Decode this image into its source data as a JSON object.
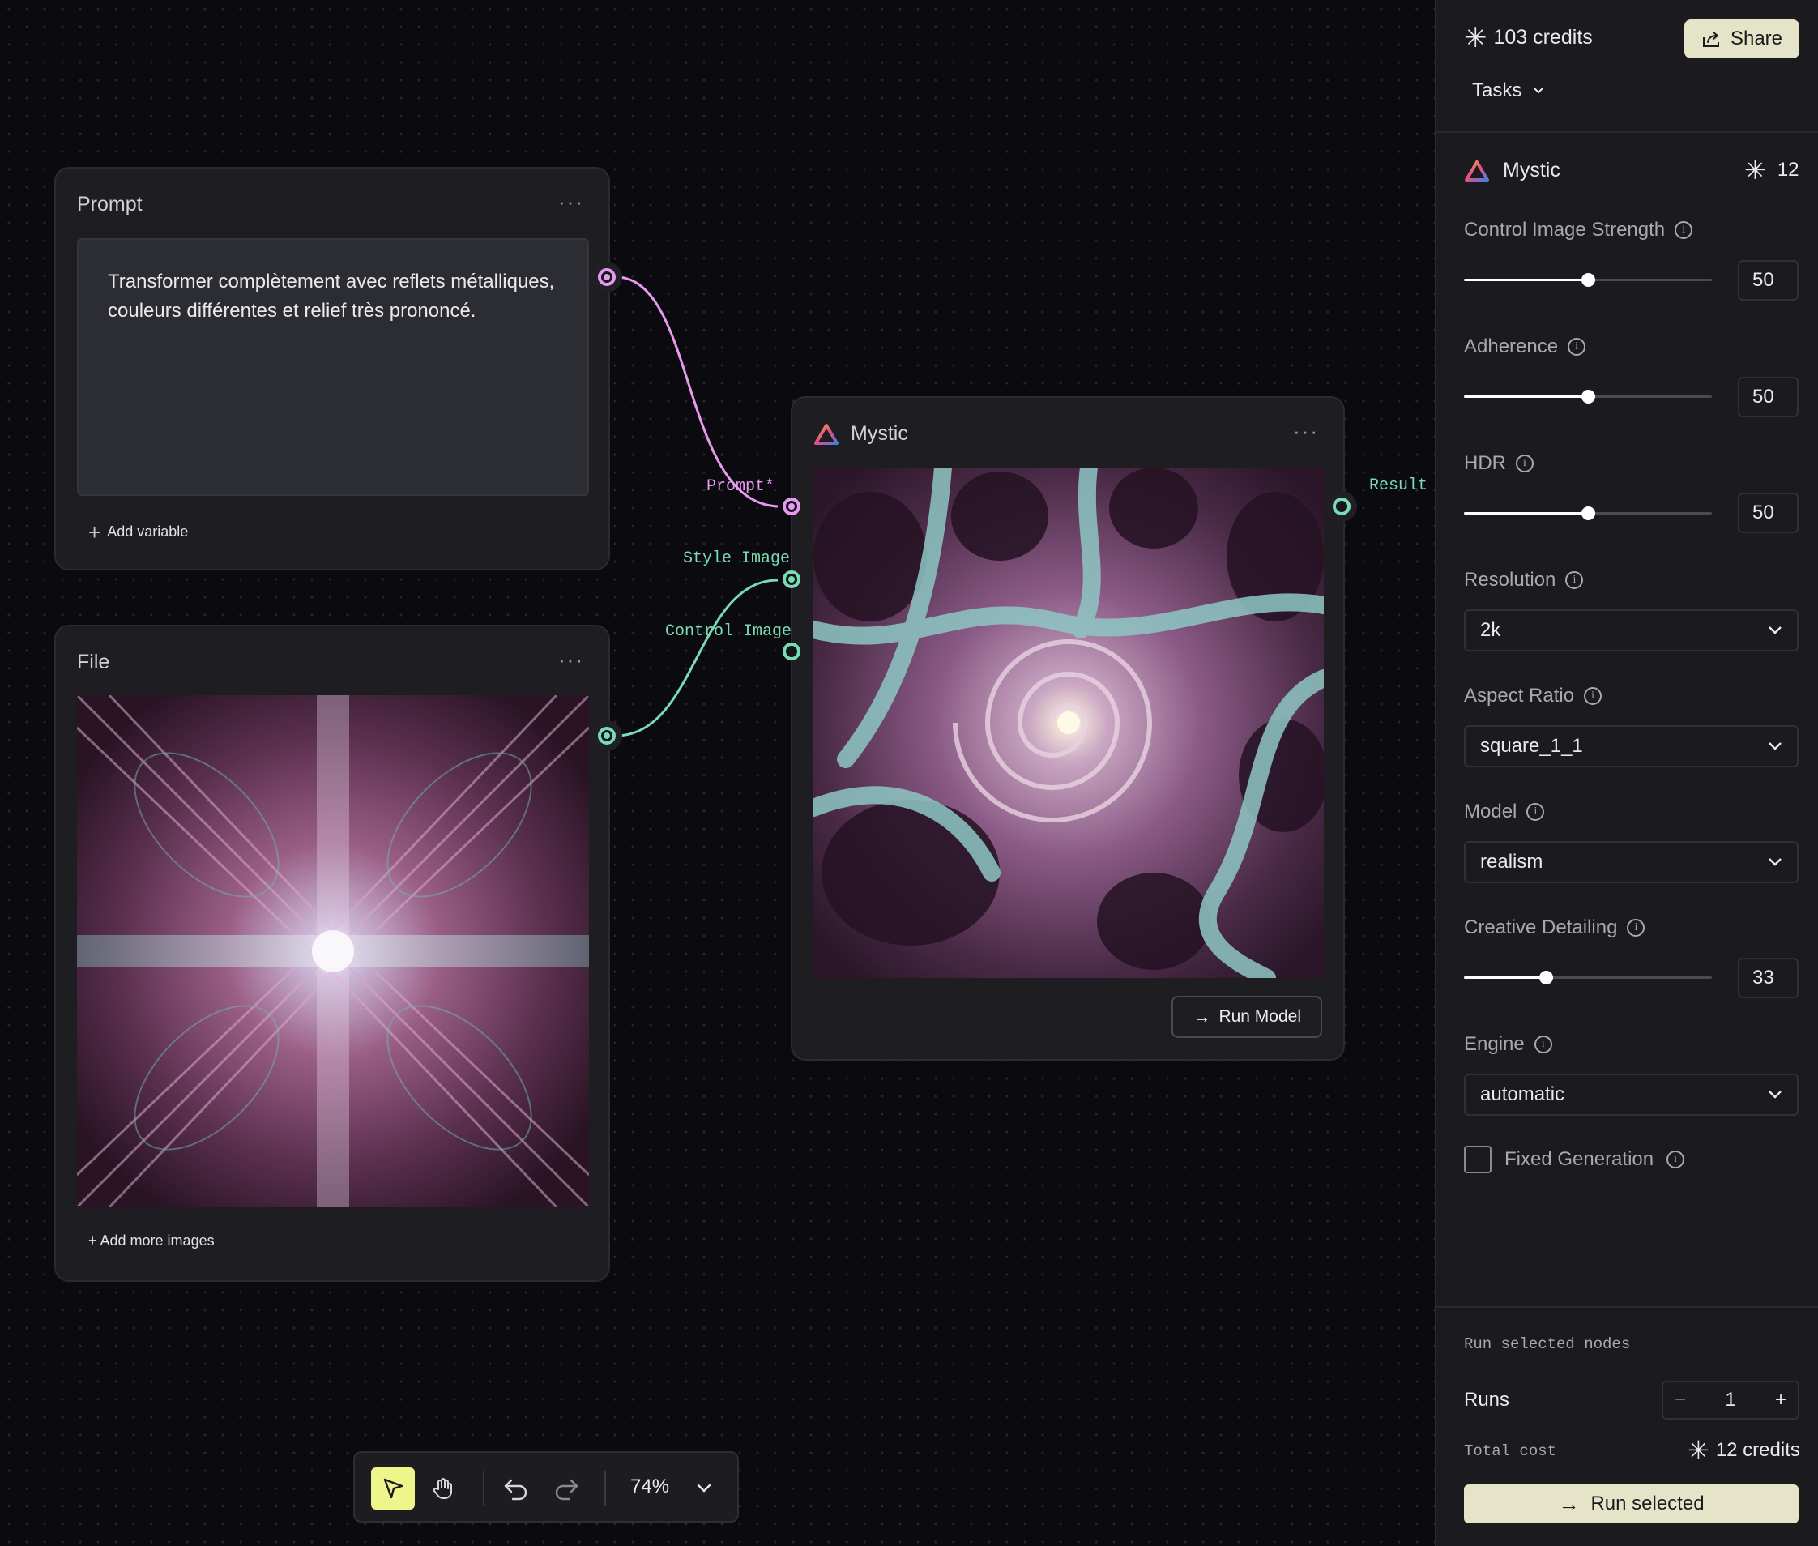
{
  "canvas": {
    "prompt_node": {
      "title": "Prompt",
      "text": "Transformer complètement avec reflets métalliques, couleurs différentes et relief très prononcé.",
      "add_variable": "Add variable",
      "menu": "···"
    },
    "file_node": {
      "title": "File",
      "add_more": "+ Add more images",
      "menu": "···"
    },
    "mystic_node": {
      "title": "Mystic",
      "menu": "···",
      "run_button": "Run Model",
      "inputs": {
        "prompt": "Prompt*",
        "style_image": "Style Image",
        "control_image": "Control Image"
      },
      "output": "Result"
    },
    "colors": {
      "prompt_wire": "#e79bf0",
      "image_wire": "#78dcb4"
    }
  },
  "toolbar": {
    "zoom": "74%",
    "select_tool_icon": "pointer-icon",
    "pan_tool_icon": "hand-icon"
  },
  "panel": {
    "credits": "103 credits",
    "share": "Share",
    "tasks": "Tasks",
    "model_name": "Mystic",
    "model_cost": "12",
    "fields": {
      "control_image_strength": {
        "label": "Control Image Strength",
        "value": "50",
        "level": 0.5
      },
      "adherence": {
        "label": "Adherence",
        "value": "50",
        "level": 0.5
      },
      "hdr": {
        "label": "HDR",
        "value": "50",
        "level": 0.5
      },
      "resolution": {
        "label": "Resolution",
        "value": "2k"
      },
      "aspect_ratio": {
        "label": "Aspect Ratio",
        "value": "square_1_1"
      },
      "model": {
        "label": "Model",
        "value": "realism"
      },
      "creative_detailing": {
        "label": "Creative Detailing",
        "value": "33",
        "level": 0.33
      },
      "engine": {
        "label": "Engine",
        "value": "automatic"
      },
      "fixed_generation": {
        "label": "Fixed Generation",
        "checked": false
      }
    },
    "footer": {
      "run_selected_nodes": "Run selected nodes",
      "runs_label": "Runs",
      "runs_value": "1",
      "minus": "−",
      "plus": "+",
      "total_cost_label": "Total cost",
      "total_cost_value": "12 credits",
      "run_selected": "Run selected"
    },
    "accent": "#e6e4c8"
  }
}
